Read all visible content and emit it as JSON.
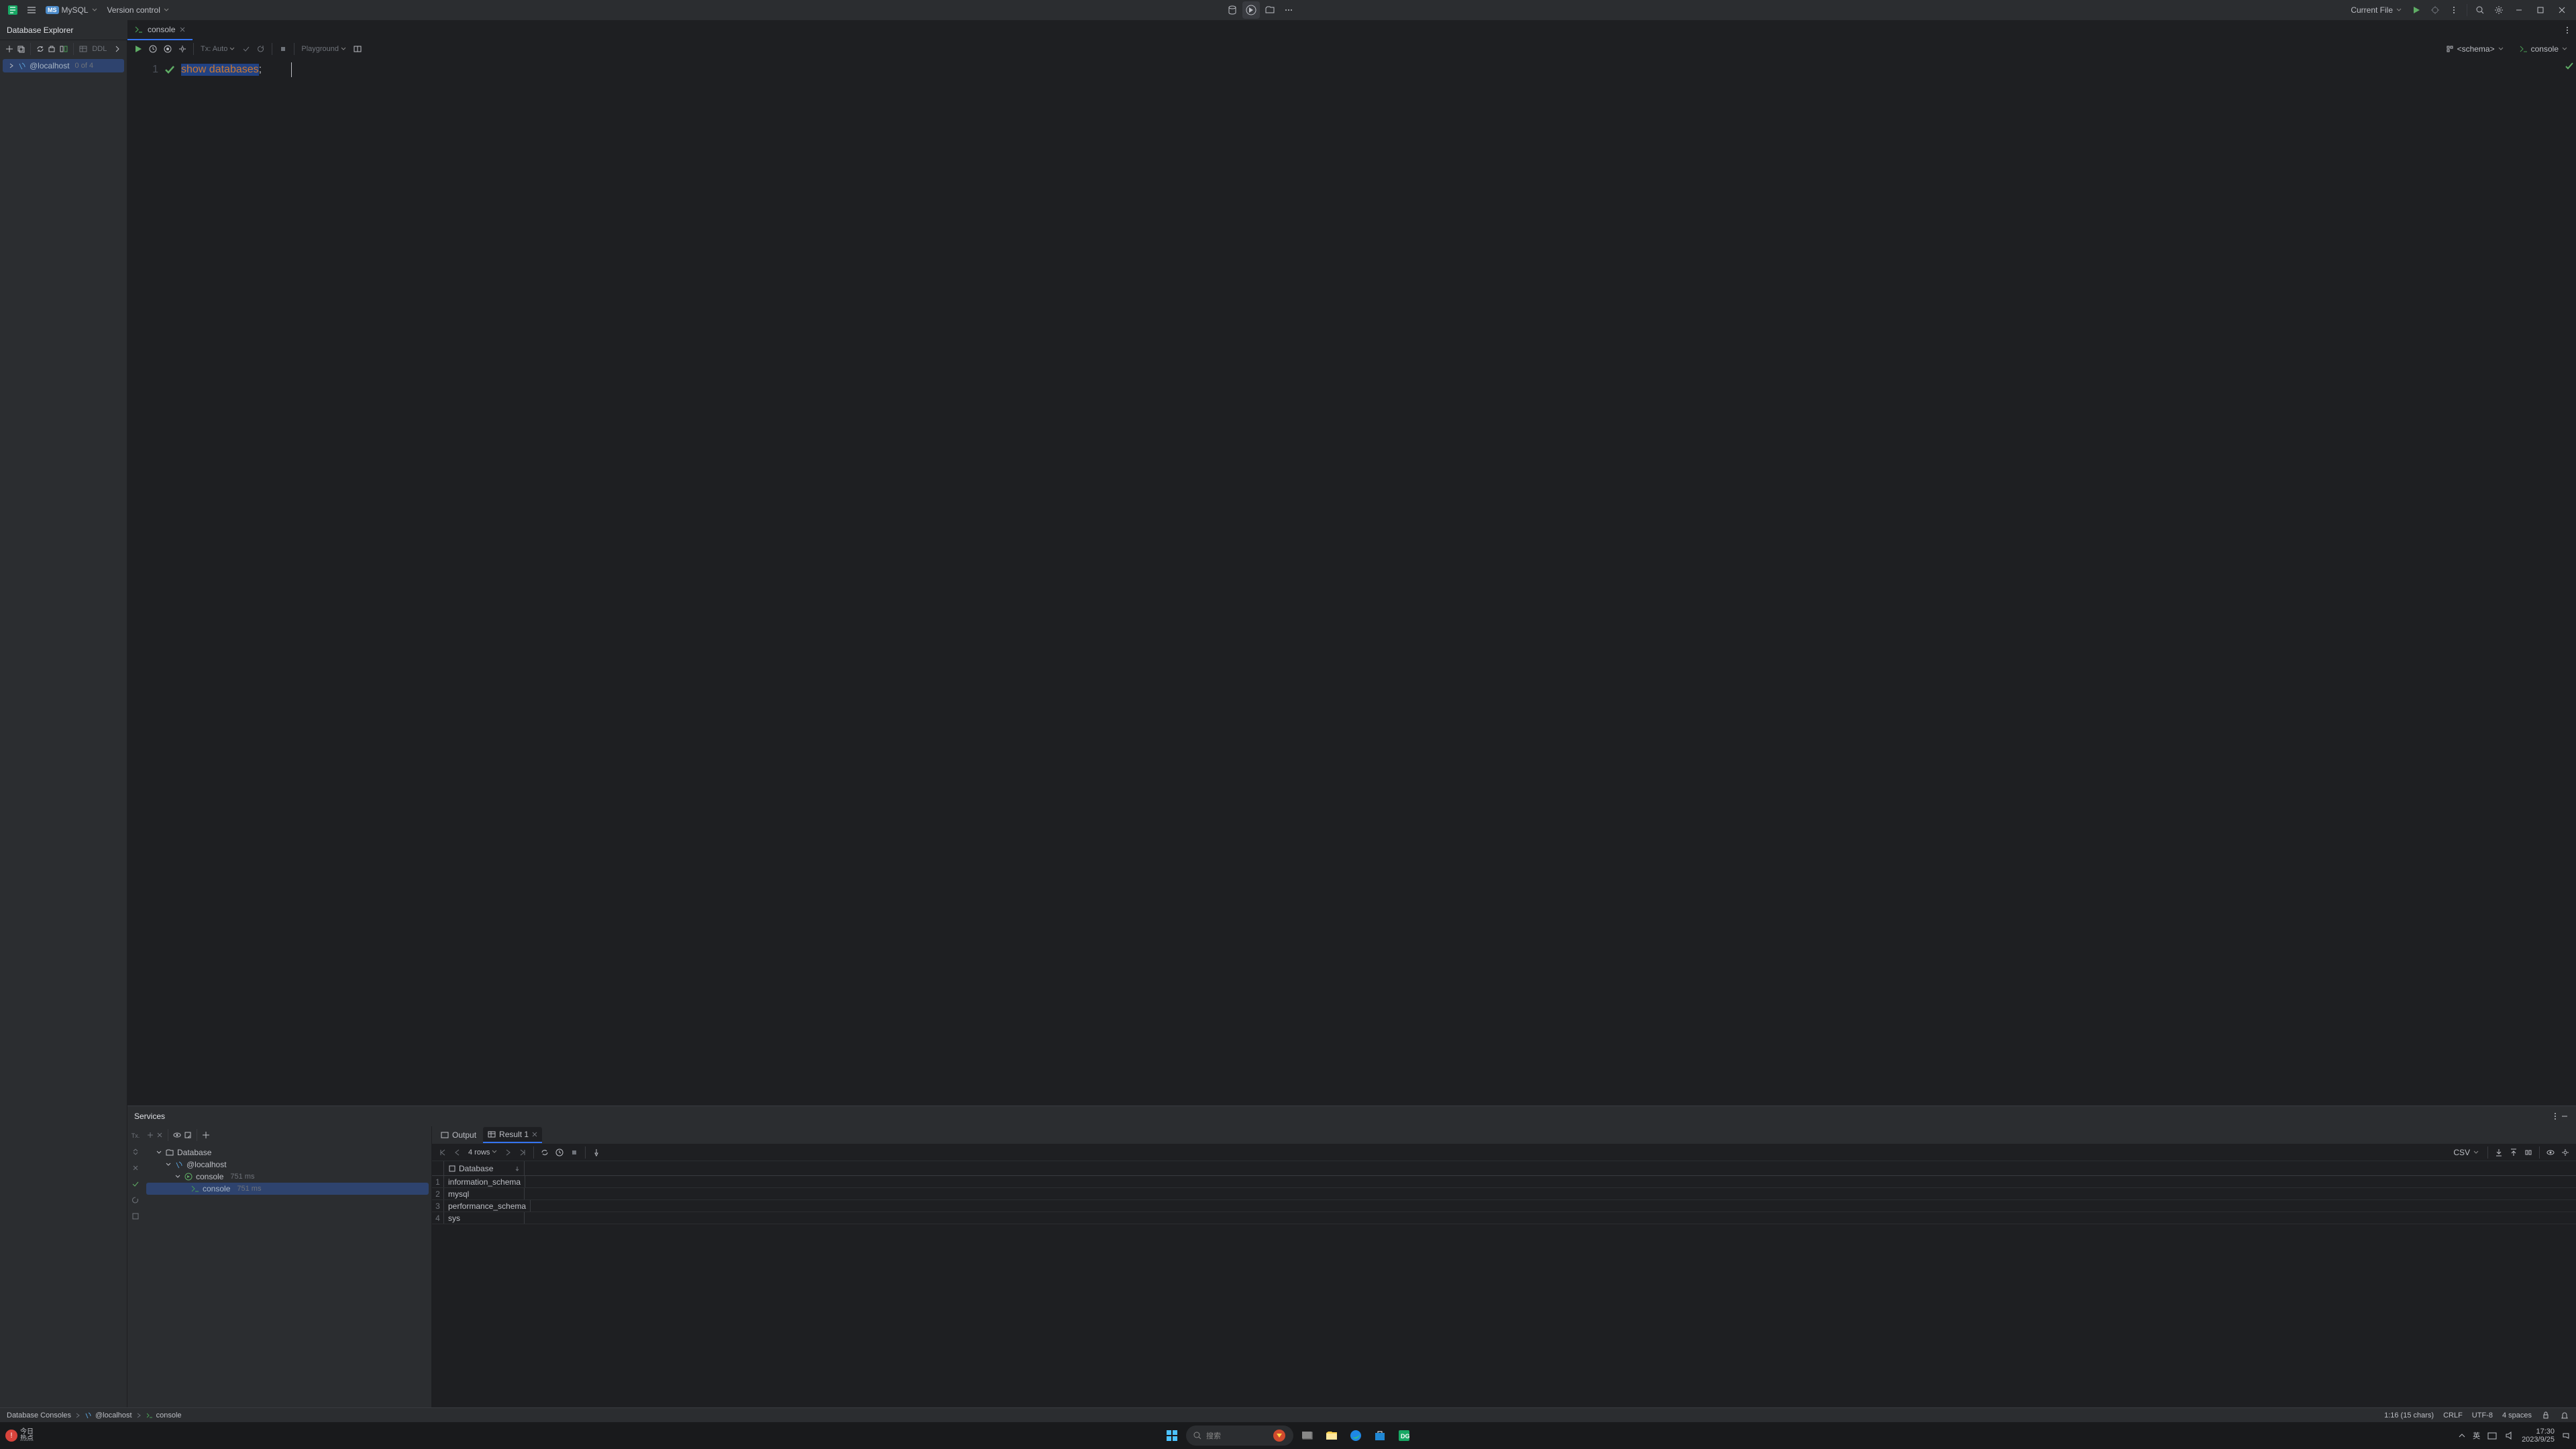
{
  "titlebar": {
    "db_type": "MySQL",
    "vcs": "Version control",
    "run_config": "Current File"
  },
  "tabs": {
    "side_title": "Database Explorer",
    "file_tab": "console"
  },
  "sidebar": {
    "ddl": "DDL",
    "host": "@localhost",
    "host_count": "0 of 4"
  },
  "editor_toolbar": {
    "tx": "Tx: Auto",
    "playground": "Playground",
    "schema": "<schema>",
    "console": "console"
  },
  "editor": {
    "line_no": "1",
    "code": "show databases;",
    "code_kw": "show databases",
    "code_punc": ";"
  },
  "services": {
    "title": "Services",
    "tx_label": "Tx.",
    "tree": {
      "root": "Database",
      "host": "@localhost",
      "console": "console",
      "dur": "751 ms",
      "leaf": "console",
      "leaf_dur": "751 ms"
    },
    "tabs": {
      "output": "Output",
      "result": "Result 1"
    },
    "result_tb": {
      "rows": "4 rows",
      "csv": "CSV"
    },
    "grid": {
      "header": "Database",
      "rows": [
        "information_schema",
        "mysql",
        "performance_schema",
        "sys"
      ]
    }
  },
  "statusbar": {
    "crumbs": [
      "Database Consoles",
      "@localhost",
      "console"
    ],
    "pos": "1:16 (15 chars)",
    "eol": "CRLF",
    "enc": "UTF-8",
    "indent": "4 spaces"
  },
  "taskbar": {
    "today1": "今日",
    "today2": "热点",
    "search": "搜索",
    "ime": "英",
    "time": "17:30",
    "date": "2023/9/25"
  }
}
